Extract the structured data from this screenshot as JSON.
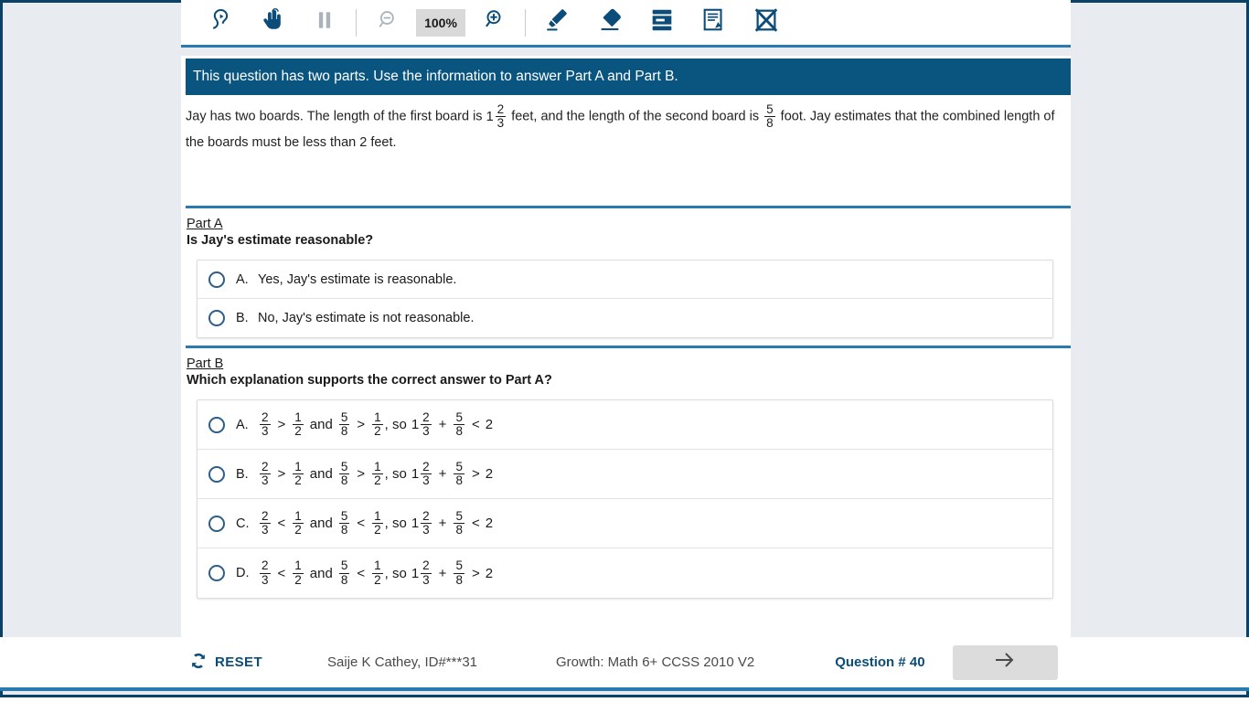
{
  "toolbar": {
    "buttons": [
      {
        "name": "listen-again",
        "icon": "ear-replay-icon",
        "state": "enabled"
      },
      {
        "name": "pointer-tool",
        "icon": "pointing-hand-icon",
        "state": "enabled"
      },
      {
        "name": "pause-audio",
        "icon": "pause-icon",
        "state": "disabled"
      },
      {
        "name": "zoom-out",
        "icon": "magnifier-minus-icon",
        "state": "disabled"
      },
      {
        "name": "zoom-in",
        "icon": "magnifier-plus-icon",
        "state": "enabled"
      },
      {
        "name": "highlighter",
        "icon": "highlighter-pen-icon",
        "state": "enabled"
      },
      {
        "name": "eraser",
        "icon": "eraser-icon",
        "state": "enabled"
      },
      {
        "name": "line-reader",
        "icon": "line-reader-icon",
        "state": "enabled"
      },
      {
        "name": "notepad",
        "icon": "notepad-pencil-icon",
        "state": "enabled"
      },
      {
        "name": "cross-out",
        "icon": "cross-out-icon",
        "state": "enabled"
      }
    ],
    "zoom_level": "100%"
  },
  "banner": {
    "text": "This question has two parts. Use the information to answer Part A and Part B."
  },
  "stem": {
    "text_1": "Jay has two boards. The length of the first board is",
    "mixed_1_whole": "1",
    "mixed_1_num": "2",
    "mixed_1_den": "3",
    "text_2": "feet, and the length of the second board is",
    "frac_2_num": "5",
    "frac_2_den": "8",
    "text_3": "foot. Jay estimates that the combined length of the boards must be less than 2 feet."
  },
  "part_a": {
    "label": "Part A",
    "question": "Is Jay's estimate reasonable?",
    "choices": [
      {
        "letter": "A.",
        "text": "Yes, Jay's estimate is reasonable."
      },
      {
        "letter": "B.",
        "text": "No, Jay's estimate is not reasonable."
      }
    ]
  },
  "part_b": {
    "label": "Part B",
    "question": "Which explanation supports the correct answer to Part A?",
    "choices": [
      {
        "letter": "A.",
        "f1_num": "2",
        "f1_den": "3",
        "op1": ">",
        "f2_num": "1",
        "f2_den": "2",
        "and": "and",
        "f3_num": "5",
        "f3_den": "8",
        "op2": ">",
        "f4_num": "1",
        "f4_den": "2",
        "so": ", so",
        "whole": "1",
        "f5_num": "2",
        "f5_den": "3",
        "plus": "+",
        "f6_num": "5",
        "f6_den": "8",
        "op3": "<",
        "result": "2"
      },
      {
        "letter": "B.",
        "f1_num": "2",
        "f1_den": "3",
        "op1": ">",
        "f2_num": "1",
        "f2_den": "2",
        "and": "and",
        "f3_num": "5",
        "f3_den": "8",
        "op2": ">",
        "f4_num": "1",
        "f4_den": "2",
        "so": ", so",
        "whole": "1",
        "f5_num": "2",
        "f5_den": "3",
        "plus": "+",
        "f6_num": "5",
        "f6_den": "8",
        "op3": ">",
        "result": "2"
      },
      {
        "letter": "C.",
        "f1_num": "2",
        "f1_den": "3",
        "op1": "<",
        "f2_num": "1",
        "f2_den": "2",
        "and": "and",
        "f3_num": "5",
        "f3_den": "8",
        "op2": "<",
        "f4_num": "1",
        "f4_den": "2",
        "so": ", so",
        "whole": "1",
        "f5_num": "2",
        "f5_den": "3",
        "plus": "+",
        "f6_num": "5",
        "f6_den": "8",
        "op3": "<",
        "result": "2"
      },
      {
        "letter": "D.",
        "f1_num": "2",
        "f1_den": "3",
        "op1": "<",
        "f2_num": "1",
        "f2_den": "2",
        "and": "and",
        "f3_num": "5",
        "f3_den": "8",
        "op2": "<",
        "f4_num": "1",
        "f4_den": "2",
        "so": ", so",
        "whole": "1",
        "f5_num": "2",
        "f5_den": "3",
        "plus": "+",
        "f6_num": "5",
        "f6_den": "8",
        "op3": ">",
        "result": "2"
      }
    ]
  },
  "footer": {
    "reset_label": "RESET",
    "reset_icon": "refresh-icon",
    "student": "Saije K Cathey, ID#***31",
    "test_name": "Growth: Math 6+ CCSS 2010 V2",
    "question_number": "Question # 40",
    "next_icon": "arrow-right-icon"
  },
  "colors": {
    "banner_blue": "#0a5580",
    "accent_blue": "#2a7ab0",
    "icon_navy": "#0b4c78",
    "page_bg": "#e8ebef",
    "frame_navy": "#0b4166"
  }
}
